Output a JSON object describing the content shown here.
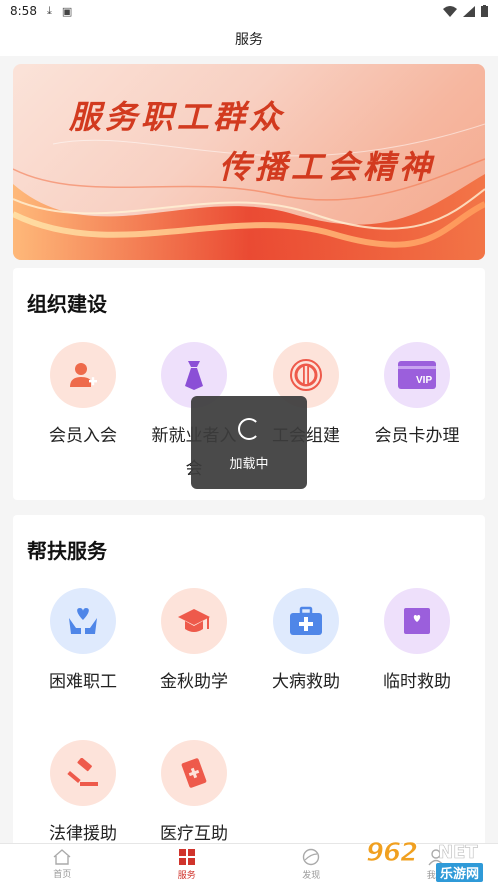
{
  "status_bar": {
    "time": "8:58"
  },
  "header": {
    "title": "服务"
  },
  "banner": {
    "line1": "服务职工群众",
    "line2": "传播工会精神"
  },
  "org_section": {
    "title": "组织建设",
    "items": [
      {
        "label": "会员入会",
        "icon": "user-add-icon",
        "bg": "#fde3da",
        "color": "#ee6a4b"
      },
      {
        "label": "新就业者入会",
        "icon": "tie-icon",
        "bg": "#eee0fb",
        "color": "#8b4fd6"
      },
      {
        "label": "工会组建",
        "icon": "union-emblem-icon",
        "bg": "#fde3da",
        "color": "#ee5a4b"
      },
      {
        "label": "会员卡办理",
        "icon": "vip-card-icon",
        "bg": "#eee0fb",
        "color": "#9b5fdc"
      }
    ]
  },
  "help_section": {
    "title": "帮扶服务",
    "items": [
      {
        "label": "困难职工",
        "icon": "hands-heart-icon",
        "bg": "#dfeafd",
        "color": "#4f86e8"
      },
      {
        "label": "金秋助学",
        "icon": "graduation-cap-icon",
        "bg": "#fde3da",
        "color": "#ee5a4b"
      },
      {
        "label": "大病救助",
        "icon": "medical-kit-icon",
        "bg": "#dfeafd",
        "color": "#4f86e8"
      },
      {
        "label": "临时救助",
        "icon": "heart-box-icon",
        "bg": "#eee0fb",
        "color": "#9b5fdc"
      },
      {
        "label": "法律援助",
        "icon": "gavel-icon",
        "bg": "#fde3da",
        "color": "#ee5a4b"
      },
      {
        "label": "医疗互助",
        "icon": "medical-note-icon",
        "bg": "#fde3da",
        "color": "#ee5a4b"
      }
    ]
  },
  "toast": {
    "text": "加载中"
  },
  "tabbar": {
    "tabs": [
      {
        "label": "首页",
        "icon": "home-icon"
      },
      {
        "label": "服务",
        "icon": "service-grid-icon",
        "active": true
      },
      {
        "label": "发现",
        "icon": "discover-icon"
      },
      {
        "label": "我的",
        "icon": "profile-icon"
      }
    ]
  },
  "watermark": {
    "brand": "962",
    "suffix": "NET",
    "sub": "乐游网"
  },
  "colors": {
    "accent": "#d0342c",
    "banner_text": "#d23a1f"
  }
}
